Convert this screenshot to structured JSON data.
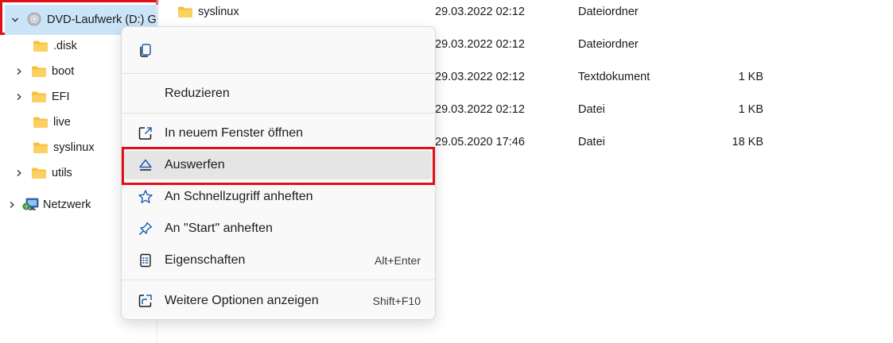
{
  "nav": {
    "drive_label": "DVD-Laufwerk (D:) G",
    "folders": [
      {
        "label": ".disk",
        "expandable": false
      },
      {
        "label": "boot",
        "expandable": true
      },
      {
        "label": "EFI",
        "expandable": true
      },
      {
        "label": "live",
        "expandable": false
      },
      {
        "label": "syslinux",
        "expandable": false
      },
      {
        "label": "utils",
        "expandable": true
      }
    ],
    "network_label": "Netzwerk"
  },
  "files": [
    {
      "name": "syslinux",
      "date": "29.03.2022 02:12",
      "type": "Dateiordner",
      "size": ""
    },
    {
      "name": "",
      "date": "29.03.2022 02:12",
      "type": "Dateiordner",
      "size": ""
    },
    {
      "name": "",
      "date": "29.03.2022 02:12",
      "type": "Textdokument",
      "size": "1 KB"
    },
    {
      "name": "",
      "date": "29.03.2022 02:12",
      "type": "Datei",
      "size": "1 KB"
    },
    {
      "name": "",
      "date": "29.05.2020 17:46",
      "type": "Datei",
      "size": "18 KB"
    }
  ],
  "menu": {
    "collapse": "Reduzieren",
    "open_new_window": "In neuem Fenster öffnen",
    "eject": "Auswerfen",
    "pin_quick_access": "An Schnellzugriff anheften",
    "pin_start": "An \"Start\" anheften",
    "properties": "Eigenschaften",
    "properties_shortcut": "Alt+Enter",
    "more_options": "Weitere Optionen anzeigen",
    "more_options_shortcut": "Shift+F10"
  },
  "colors": {
    "selection": "#cce4f7",
    "highlight_border": "#e0101a",
    "folder": "#f8c13a",
    "icon_blue": "#1a5fb4"
  },
  "icons": {
    "drive": "dvd-drive-icon",
    "folder": "folder-icon",
    "network": "network-icon",
    "copy": "copy-icon",
    "open_new_window": "open-external-icon",
    "eject": "eject-icon",
    "pin_quick_access": "star-icon",
    "pin_start": "pin-icon",
    "properties": "properties-icon",
    "more_options": "share-more-icon"
  }
}
